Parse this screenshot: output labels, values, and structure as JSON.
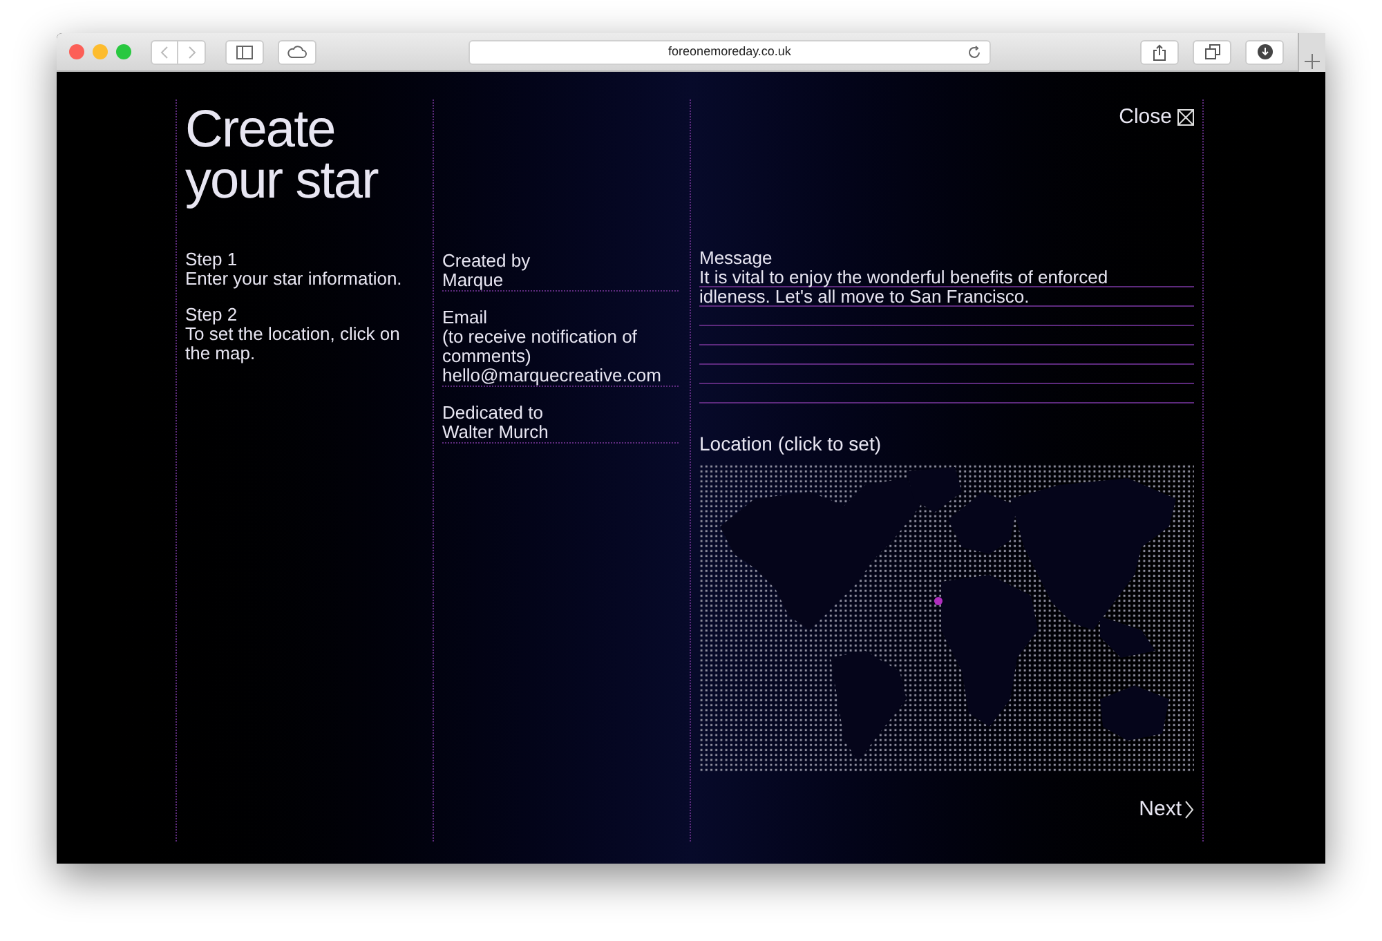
{
  "browser": {
    "url": "foreonemoreday.co.uk"
  },
  "title": "Create your star",
  "close": "Close",
  "steps": [
    {
      "label": "Step 1",
      "text": "Enter your star information."
    },
    {
      "label": "Step 2",
      "text": "To set the location, click on the map."
    }
  ],
  "fields": [
    {
      "label": "Created by",
      "value": "Marque"
    },
    {
      "label": "Email",
      "hint": "(to receive notification of comments)",
      "value": "hello@marquecreative.com"
    },
    {
      "label": "Dedicated to",
      "value": "Walter Murch"
    }
  ],
  "message": {
    "label": "Message",
    "value": "It is vital to enjoy the wonderful benefits of enforced idleness. Let's all move to San Francisco."
  },
  "location": {
    "label": "Location (click to set)"
  },
  "next": "Next"
}
